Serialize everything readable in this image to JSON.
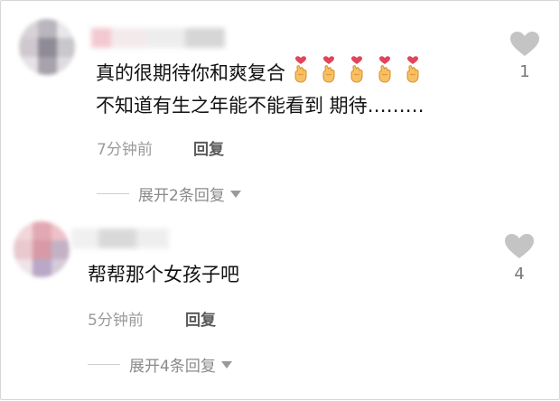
{
  "comments": [
    {
      "text_line1": "真的很期待你和爽复合",
      "emoji_count": 5,
      "emoji_name": "finger-heart-emoji",
      "text_line2": "不知道有生之年能不能看到 期待………",
      "time": "7分钟前",
      "reply_label": "回复",
      "expand_label": "展开2条回复",
      "like_count": "1"
    },
    {
      "text_line1": "帮帮那个女孩子吧",
      "time": "5分钟前",
      "reply_label": "回复",
      "expand_label": "展开4条回复",
      "like_count": "4"
    }
  ],
  "colors": {
    "text": "#111111",
    "meta": "#9b9b9b",
    "like_icon": "#c4c4c4"
  },
  "icons": {
    "like": "heart-icon",
    "expand": "caret-down-icon"
  }
}
